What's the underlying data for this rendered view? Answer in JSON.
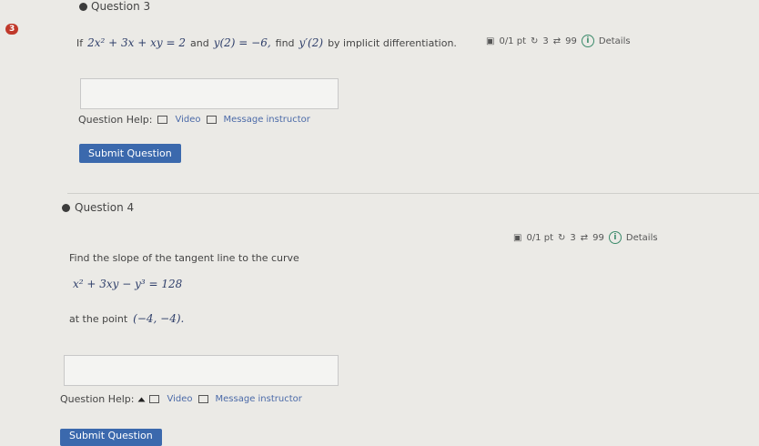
{
  "q3": {
    "badge": "3",
    "title": "Question 3",
    "meta": {
      "points": "0/1 pt",
      "retries": "3",
      "attempts": "99",
      "details": "Details"
    },
    "prompt_lead": "If",
    "equation": "2x² + 3x + xy = 2",
    "and": "and",
    "condition": "y(2) = −6,",
    "find": "find",
    "target": "y′(2)",
    "method": "by implicit differentiation.",
    "help_label": "Question Help:",
    "video": "Video",
    "message": "Message instructor",
    "submit": "Submit Question"
  },
  "q4": {
    "title": "Question 4",
    "meta": {
      "points": "0/1 pt",
      "retries": "3",
      "attempts": "99",
      "details": "Details"
    },
    "prompt": "Find the slope of the tangent line to the curve",
    "equation": "x² + 3xy − y³ = 128",
    "point_lead": "at the point",
    "point": "(−4, −4).",
    "help_label": "Question Help:",
    "video": "Video",
    "message": "Message instructor",
    "submit": "Submit Question"
  },
  "colors": {
    "accent": "#3b69ad",
    "badge": "#c0392b",
    "details_icon": "#3a8a6a",
    "background": "#ebeae6"
  }
}
